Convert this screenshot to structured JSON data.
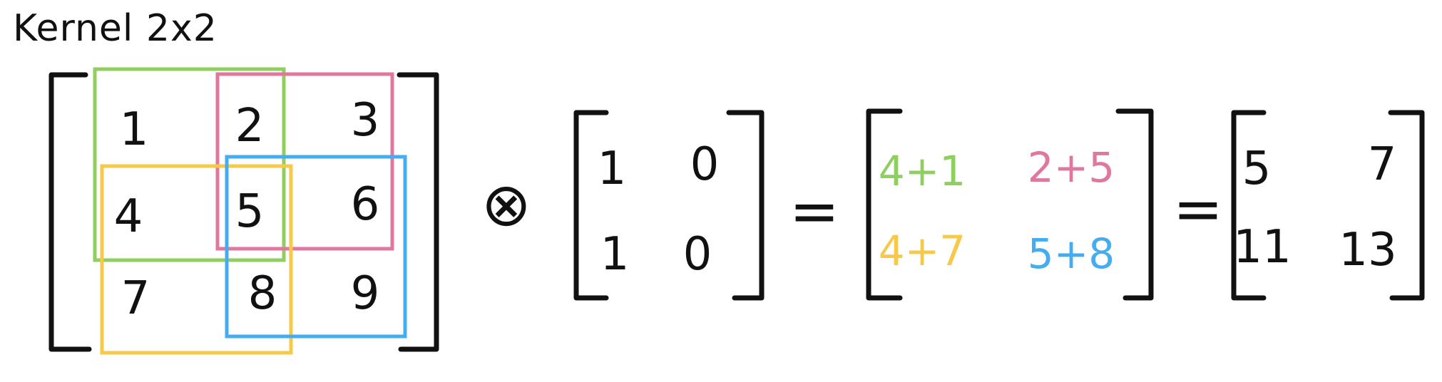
{
  "title": "Kernel 2x2",
  "colors": {
    "ink": "#111111",
    "green": "#8fcf5f",
    "pink": "#e0779f",
    "yellow": "#f6c94a",
    "blue": "#45adef"
  },
  "input_matrix": {
    "cells": [
      "1",
      "2",
      "3",
      "4",
      "5",
      "6",
      "7",
      "8",
      "9"
    ]
  },
  "operator": "⊗",
  "kernel_matrix": {
    "cells": [
      "1",
      "0",
      "1",
      "0"
    ]
  },
  "equals_1": "=",
  "sum_matrix": {
    "cells": [
      "4+1",
      "2+5",
      "4+7",
      "5+8"
    ],
    "cell_colors": [
      "green",
      "pink",
      "yellow",
      "blue"
    ]
  },
  "equals_2": "=",
  "result_matrix": {
    "cells": [
      "5",
      "7",
      "11",
      "13"
    ]
  }
}
